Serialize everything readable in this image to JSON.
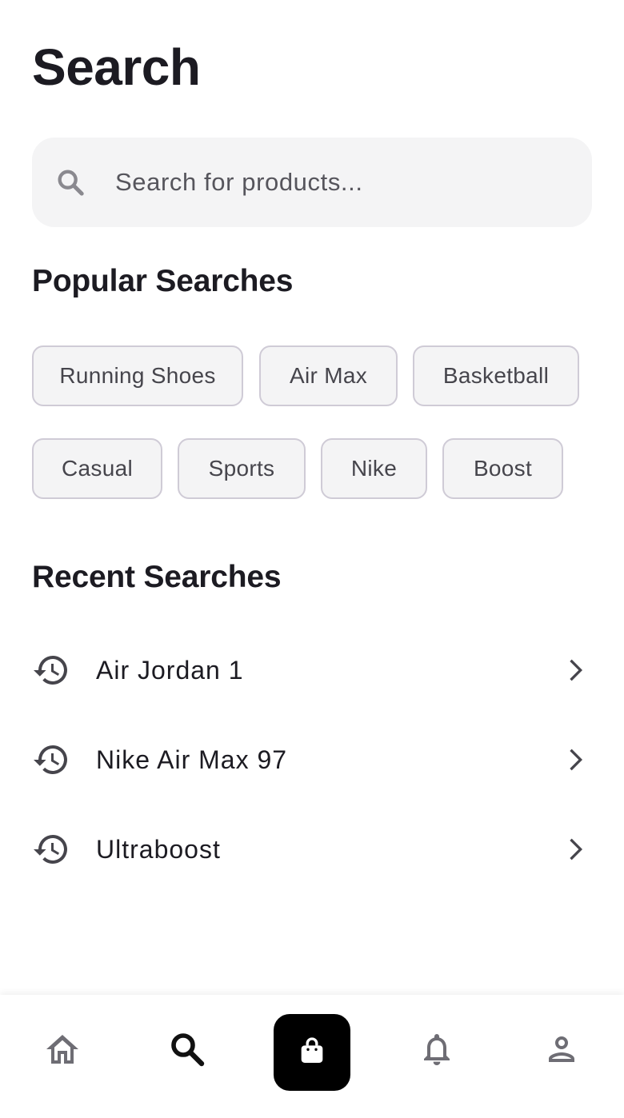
{
  "header": {
    "title": "Search"
  },
  "search": {
    "placeholder": "Search for products...",
    "value": ""
  },
  "popular": {
    "title": "Popular Searches",
    "chips": [
      "Running Shoes",
      "Air Max",
      "Basketball",
      "Casual",
      "Sports",
      "Nike",
      "Boost"
    ]
  },
  "recent": {
    "title": "Recent Searches",
    "items": [
      {
        "label": "Air Jordan 1",
        "icon": "history-icon",
        "action_icon": "chevron-right-icon"
      },
      {
        "label": "Nike Air Max 97",
        "icon": "history-icon",
        "action_icon": "chevron-right-icon"
      },
      {
        "label": "Ultraboost",
        "icon": "history-icon",
        "action_icon": "chevron-right-icon"
      }
    ]
  },
  "bottom_nav": {
    "items": [
      {
        "icon": "home-icon",
        "active": false
      },
      {
        "icon": "search-icon",
        "active": true
      },
      {
        "icon": "shopping-bag-icon",
        "active": false
      },
      {
        "icon": "bell-icon",
        "active": false
      },
      {
        "icon": "profile-icon",
        "active": false
      }
    ]
  },
  "colors": {
    "text_primary": "#1c1b22",
    "chip_border": "#cfcbd6",
    "chip_bg": "#f4f4f5",
    "search_bg": "#f4f4f5",
    "nav_inactive": "#6e6d74",
    "nav_active": "#111111",
    "cart_bg": "#000000"
  }
}
